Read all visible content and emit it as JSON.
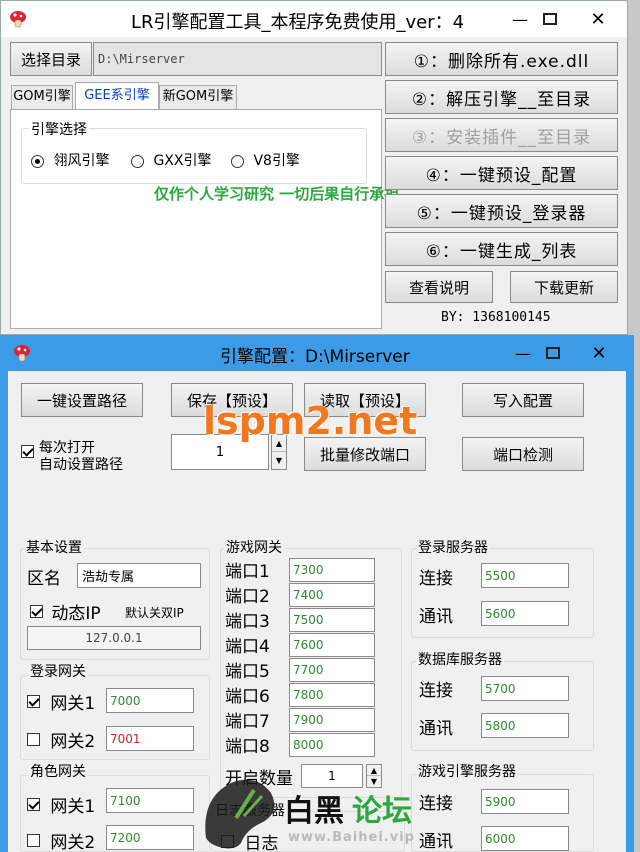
{
  "win1": {
    "title": "LR引擎配置工具_本程序免费使用_ver：4",
    "dir_button": "选择目录",
    "dir_path": "D:\\Mirserver",
    "tabs": [
      "GOM引擎",
      "GEE系引擎",
      "新GOM引擎"
    ],
    "engine_group": "引擎选择",
    "radios": [
      "翎风引擎",
      "GXX引擎",
      "V8引擎"
    ],
    "notice": "仅作个人学习研究  一切后果自行承担",
    "actions": [
      "①：删除所有.exe.dll",
      "②：解压引擎__至目录",
      "③：安装插件__至目录",
      "④：一键预设_配置",
      "⑤：一键预设_登录器",
      "⑥：一键生成_列表"
    ],
    "help_button": "查看说明",
    "update_button": "下载更新",
    "by": "BY: 1368100145"
  },
  "win2": {
    "title": "引擎配置：D:\\Mirserver",
    "btn_set_path": "一键设置路径",
    "btn_save": "保存【预设】",
    "btn_load": "读取【预设】",
    "btn_write": "写入配置",
    "auto_path_line1": "每次打开",
    "auto_path_line2": "自动设置路径",
    "count_value": "1",
    "btn_batch": "批量修改端口",
    "btn_check": "端口检测",
    "basic": {
      "label": "基本设置",
      "zone_label": "区名",
      "zone_value": "浩劫专属",
      "dyn_ip": "动态IP",
      "dual_ip": "默认关双IP",
      "ip": "127.0.0.1"
    },
    "login_gw": {
      "label": "登录网关",
      "gw1": "网关1",
      "gw1_val": "7000",
      "gw2": "网关2",
      "gw2_val": "7001"
    },
    "role_gw": {
      "label": "角色网关",
      "gw1": "网关1",
      "gw1_val": "7100",
      "gw2": "网关2",
      "gw2_val": "7200"
    },
    "game_gw": {
      "label": "游戏网关",
      "ports": [
        {
          "name": "端口1",
          "value": "7300"
        },
        {
          "name": "端口2",
          "value": "7400"
        },
        {
          "name": "端口3",
          "value": "7500"
        },
        {
          "name": "端口4",
          "value": "7600"
        },
        {
          "name": "端口5",
          "value": "7700"
        },
        {
          "name": "端口6",
          "value": "7800"
        },
        {
          "name": "端口7",
          "value": "7900"
        },
        {
          "name": "端口8",
          "value": "8000"
        }
      ],
      "open_count_label": "开启数量",
      "open_count": "1"
    },
    "log_server": {
      "label": "日志服务器",
      "name": "日志"
    },
    "login_srv": {
      "label": "登录服务器",
      "conn": "连接",
      "conn_val": "5500",
      "comm": "通讯",
      "comm_val": "5600"
    },
    "db_srv": {
      "label": "数据库服务器",
      "conn": "连接",
      "conn_val": "5700",
      "comm": "通讯",
      "comm_val": "5800"
    },
    "engine_srv": {
      "label": "游戏引擎服务器",
      "conn": "连接",
      "conn_val": "5900",
      "comm": "通讯",
      "comm_val": "6000"
    }
  },
  "watermark": {
    "main": "lspm2.net",
    "forum_a": "白黑",
    "forum_b": "论坛",
    "url": "www.Baihei.vip"
  },
  "colors": {
    "accent_green": "#2aaa3c",
    "watermark_orange": "#f07820",
    "value_green": "#2e8b2e",
    "value_red": "#d42020",
    "titlebar_blue": "#3c9be6"
  }
}
